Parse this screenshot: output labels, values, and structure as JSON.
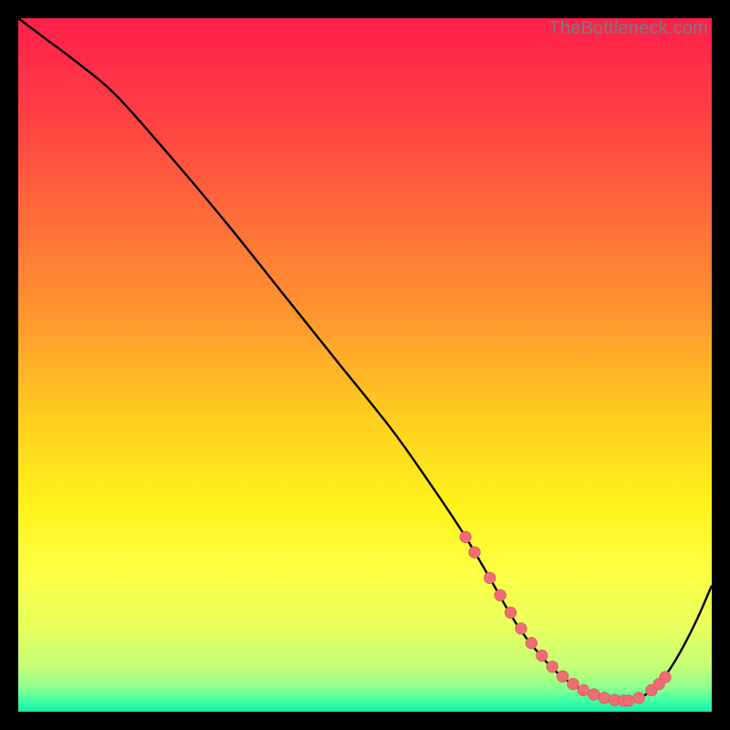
{
  "watermark": "TheBottleneck.com",
  "colors": {
    "bg": "#000000",
    "curve": "#000000",
    "marker_fill": "#ef6e74",
    "marker_stroke": "#d9575e",
    "gradient_stops": [
      {
        "offset": 0.0,
        "color": "#ff1f4b"
      },
      {
        "offset": 0.12,
        "color": "#ff3a45"
      },
      {
        "offset": 0.28,
        "color": "#ff6a3a"
      },
      {
        "offset": 0.44,
        "color": "#ff9a2e"
      },
      {
        "offset": 0.58,
        "color": "#ffcf1f"
      },
      {
        "offset": 0.7,
        "color": "#fff21a"
      },
      {
        "offset": 0.8,
        "color": "#fdff45"
      },
      {
        "offset": 0.88,
        "color": "#e7ff5e"
      },
      {
        "offset": 0.935,
        "color": "#c4ff76"
      },
      {
        "offset": 0.965,
        "color": "#8dff8d"
      },
      {
        "offset": 0.985,
        "color": "#3effa6"
      },
      {
        "offset": 1.0,
        "color": "#17e8a8"
      }
    ]
  },
  "chart_data": {
    "type": "line",
    "title": "",
    "xlabel": "",
    "ylabel": "",
    "xlim": [
      0,
      100
    ],
    "ylim": [
      0,
      100
    ],
    "series": [
      {
        "name": "bottleneck-curve",
        "x": [
          0,
          4,
          8,
          14,
          22,
          30,
          38,
          46,
          54,
          60,
          64,
          67,
          69,
          71,
          73,
          75,
          77,
          79,
          81,
          83,
          85,
          87,
          88.5,
          90,
          92,
          94,
          96,
          98,
          100
        ],
        "y": [
          100,
          97,
          94,
          89,
          80,
          70.5,
          60.5,
          50.5,
          40.5,
          32,
          26,
          21,
          17.5,
          14,
          11,
          8.5,
          6.3,
          4.6,
          3.3,
          2.4,
          1.8,
          1.6,
          1.7,
          2.2,
          3.6,
          6.2,
          9.6,
          13.6,
          18.2
        ]
      }
    ],
    "markers": {
      "name": "highlight-points",
      "x": [
        64.5,
        65.8,
        68.0,
        69.5,
        71.0,
        72.5,
        74.0,
        75.5,
        77.0,
        78.5,
        80.0,
        81.5,
        83.0,
        84.5,
        86.0,
        87.3,
        88.0,
        89.5,
        91.3,
        92.4,
        93.3
      ],
      "y": [
        25.2,
        23.0,
        19.3,
        16.8,
        14.3,
        12.0,
        9.9,
        8.1,
        6.5,
        5.1,
        4.0,
        3.1,
        2.5,
        2.0,
        1.7,
        1.6,
        1.6,
        2.0,
        3.1,
        4.0,
        5.0
      ]
    }
  }
}
